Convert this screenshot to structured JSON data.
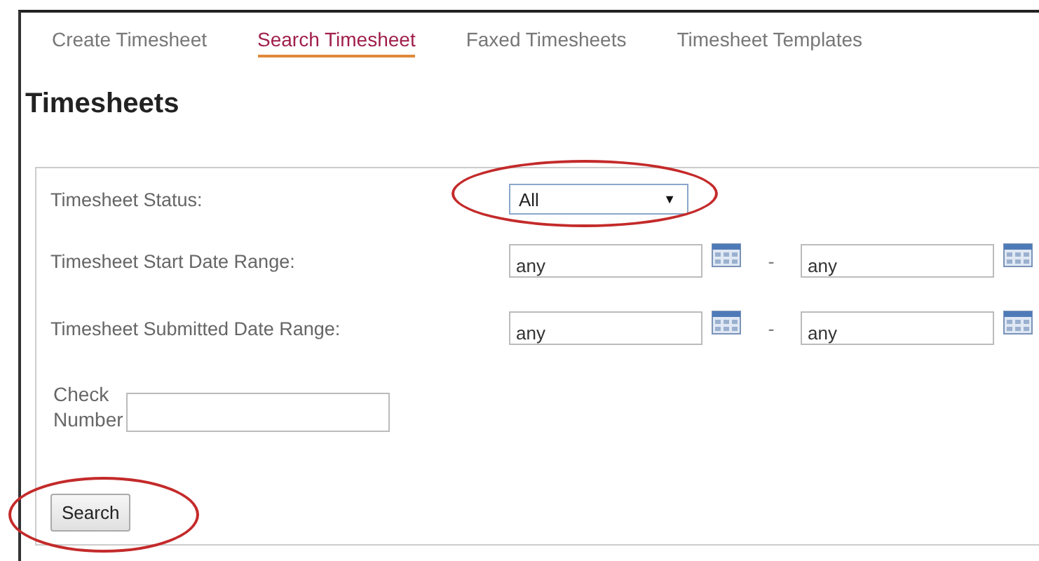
{
  "tabs": [
    {
      "label": "Create Timesheet",
      "selected": false
    },
    {
      "label": "Search Timesheet",
      "selected": true
    },
    {
      "label": "Faxed Timesheets",
      "selected": false
    },
    {
      "label": "Timesheet Templates",
      "selected": false
    }
  ],
  "heading": "Timesheets",
  "form": {
    "status": {
      "label": "Timesheet Status:",
      "value": "All",
      "arrow": "▼",
      "highlighted": true
    },
    "ranges": [
      {
        "label": "Timesheet Start Date Range:",
        "from": "any",
        "separator": "-",
        "to": "any"
      },
      {
        "label": "Timesheet Submitted Date Range:",
        "from": "any",
        "separator": "-",
        "to": "any"
      }
    ],
    "check_number": {
      "label_lines": [
        "Check",
        "Number"
      ]
    },
    "search_button": {
      "label": "Search",
      "highlighted": true
    }
  }
}
